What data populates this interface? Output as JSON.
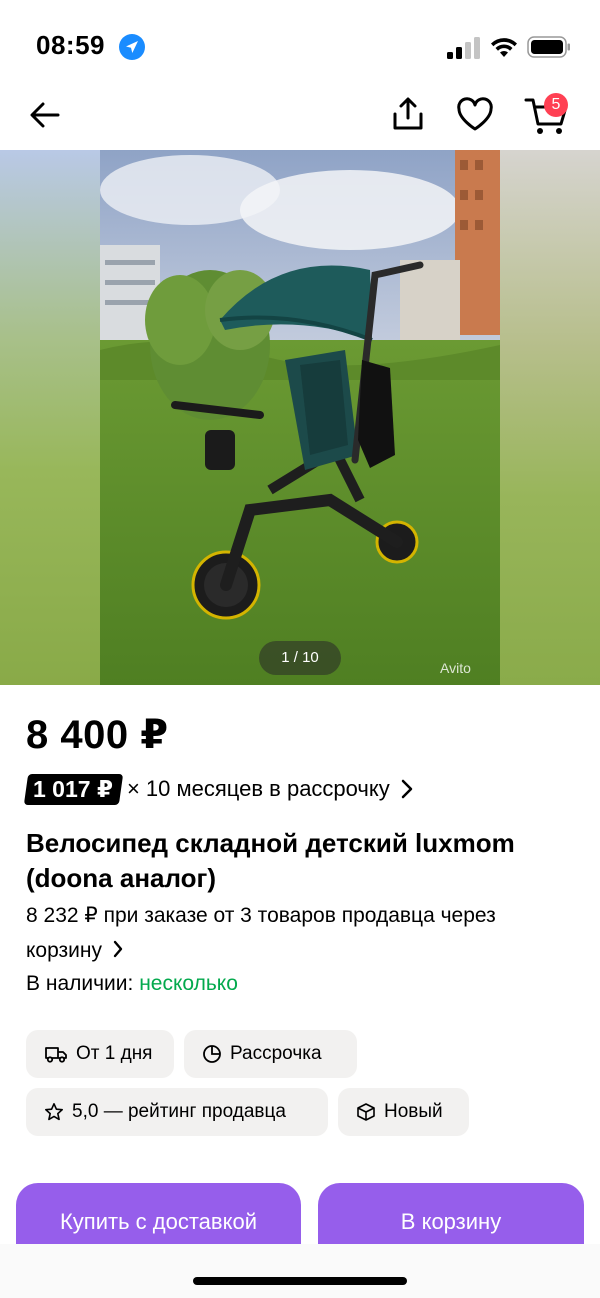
{
  "status_bar": {
    "time": "08:59",
    "icons": [
      "location-arrow-icon",
      "cellular-signal-icon",
      "wifi-icon",
      "battery-icon"
    ]
  },
  "nav": {
    "icons": [
      "back-arrow-icon",
      "share-icon",
      "heart-icon",
      "cart-icon"
    ],
    "cart_count": "5"
  },
  "gallery": {
    "counter": "1 / 10",
    "watermark": "Avito"
  },
  "listing": {
    "price": "8 400 ₽",
    "installment_amount": "1 017 ₽",
    "installment_text": "× 10 месяцев в рассрочку",
    "title": "Велосипед складной детский luxmom (doona аналог)",
    "multi_price": "8 232 ₽ при заказе от 3 товаров продавца через корзину",
    "availability_label": "В наличии:",
    "availability_value": "несколько"
  },
  "chips": [
    {
      "label": "От 1 дня",
      "icon": "truck-icon"
    },
    {
      "label": "Рассрочка",
      "icon": "pie-chart-icon"
    },
    {
      "label": "5,0 — рейтинг продавца",
      "icon": "star-icon"
    },
    {
      "label": "Новый",
      "icon": "box-icon"
    }
  ],
  "actions": {
    "buy_delivery": "Купить с доставкой",
    "add_to_cart": "В корзину"
  },
  "colors": {
    "accent": "#965eeb",
    "badge": "#ff4053",
    "availability": "#03a94d",
    "chip_bg": "#f2f1f0"
  }
}
